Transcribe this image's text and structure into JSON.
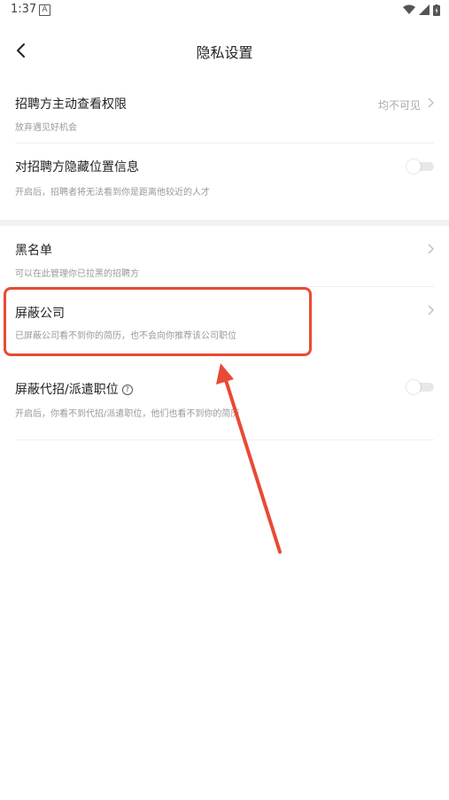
{
  "status_bar": {
    "time": "1:37",
    "notif_icon": "A"
  },
  "header": {
    "title": "隐私设置"
  },
  "settings": [
    {
      "title": "招聘方主动查看权限",
      "subtitle": "放弃遇见好机会",
      "value": "均不可见"
    },
    {
      "title": "对招聘方隐藏位置信息",
      "subtitle": "开启后，招聘者将无法看到你是距离他较近的人才",
      "toggle_on": false
    },
    {
      "title": "黑名单",
      "subtitle": "可以在此管理你已拉黑的招聘方"
    },
    {
      "title": "屏蔽公司",
      "subtitle": "已屏蔽公司看不到你的简历，也不会向你推荐该公司职位"
    },
    {
      "title": "屏蔽代招/派遣职位",
      "subtitle": "开启后，你看不到代招/派遣职位，他们也看不到你的简历",
      "toggle_on": false
    }
  ],
  "colors": {
    "highlight": "#e84a35",
    "section_gap": "#f1f2f5"
  }
}
